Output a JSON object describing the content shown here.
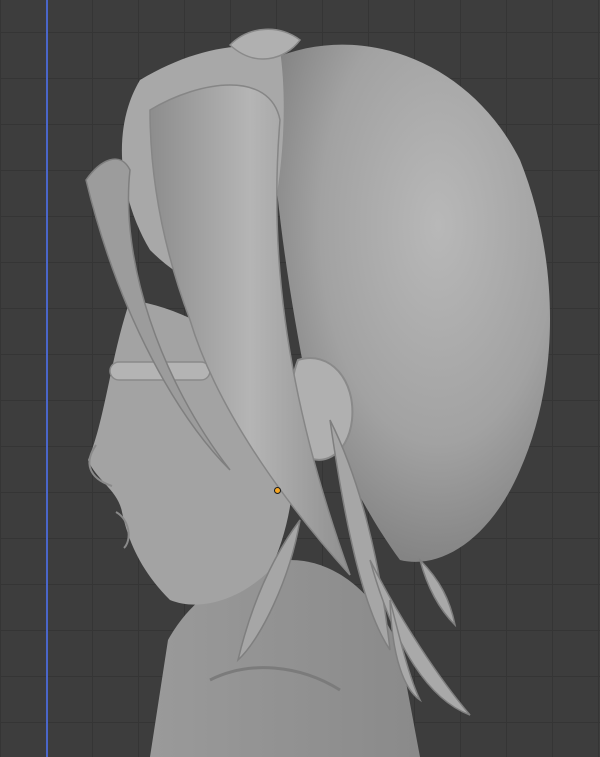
{
  "viewport": {
    "grid_color": "#353535",
    "background_color": "#3d3d3d",
    "axis_color": "#4a66c9",
    "origin_color": "#f5a623",
    "model_color": "#a6a6a6",
    "model_shadow_color": "#7c7c7c",
    "model_highlight_color": "#c4c4c4"
  }
}
